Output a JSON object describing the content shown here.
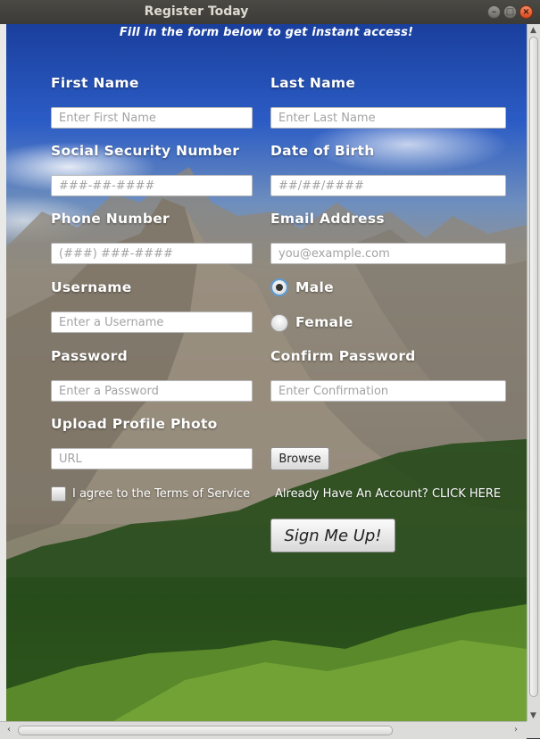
{
  "window": {
    "title": "Register Today"
  },
  "form": {
    "headline": "Fill in the form below to get instant access!",
    "first_name": {
      "label": "First Name",
      "placeholder": "Enter First Name"
    },
    "last_name": {
      "label": "Last Name",
      "placeholder": "Enter Last Name"
    },
    "ssn": {
      "label": "Social Security Number",
      "placeholder": "###-##-####"
    },
    "dob": {
      "label": "Date of Birth",
      "placeholder": "##/##/####"
    },
    "phone": {
      "label": "Phone Number",
      "placeholder": "(###) ###-####"
    },
    "email": {
      "label": "Email Address",
      "placeholder": "you@example.com"
    },
    "username": {
      "label": "Username",
      "placeholder": "Enter a Username"
    },
    "gender": {
      "options": [
        "Male",
        "Female"
      ],
      "selected": "Male"
    },
    "password": {
      "label": "Password",
      "placeholder": "Enter a Password"
    },
    "confirm_password": {
      "label": "Confirm Password",
      "placeholder": "Enter Confirmation"
    },
    "photo": {
      "label": "Upload Profile Photo",
      "placeholder": "URL",
      "browse_label": "Browse"
    },
    "terms_label": "I agree to the Terms of Service",
    "login_link": "Already Have An Account? CLICK HERE",
    "submit_label": "Sign Me Up!"
  },
  "icons": {
    "minimize": "minimize-icon",
    "maximize": "maximize-icon",
    "close": "close-icon"
  }
}
